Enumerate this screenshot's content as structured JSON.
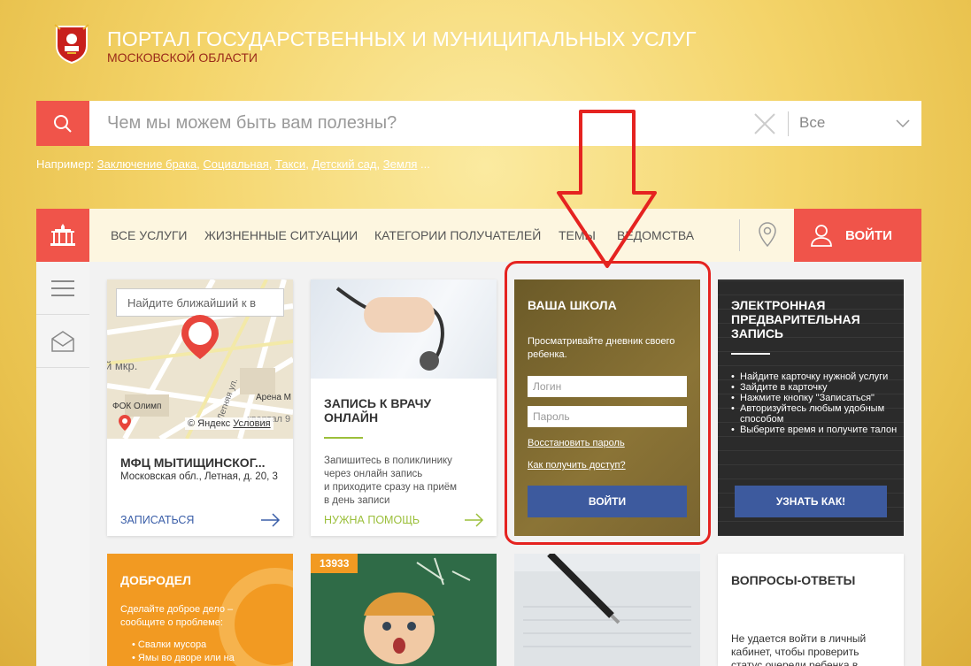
{
  "header": {
    "title": "ПОРТАЛ ГОСУДАРСТВЕННЫХ И МУНИЦИПАЛЬНЫХ УСЛУГ",
    "subtitle": "МОСКОВСКОЙ ОБЛАСТИ"
  },
  "search": {
    "placeholder": "Чем мы можем быть вам полезны?",
    "scope": "Все",
    "examples_label": "Например:",
    "examples": [
      "Заключение брака",
      "Социальная",
      "Такси",
      "Детский сад",
      "Земля"
    ],
    "ellipsis": " ..."
  },
  "nav": {
    "items": [
      "ВСЕ УСЛУГИ",
      "ЖИЗНЕННЫЕ СИТУАЦИИ",
      "КАТЕГОРИИ ПОЛУЧАТЕЛЕЙ",
      "ТЕМЫ",
      "ВЕДОМСТВА"
    ],
    "login": "ВОЙТИ"
  },
  "mfc": {
    "map_placeholder": "Найдите ближайший к в",
    "map_labels": [
      "й мкр.",
      "ФОК Олимп",
      "Арена М",
      "Летняя ул.",
      "квартал 9"
    ],
    "yandex": "© Яндекс",
    "terms": "Условия",
    "title": "МФЦ МЫТИЩИНСКОГ...",
    "address": "Московская обл., Летная, д. 20, 3",
    "link": "ЗАПИСАТЬСЯ"
  },
  "doctor": {
    "title": "ЗАПИСЬ К ВРАЧУ ОНЛАЙН",
    "text": [
      "Запишитесь в поликлинику",
      "через онлайн запись",
      "и приходите сразу на приём",
      "в день записи"
    ],
    "link": "НУЖНА ПОМОЩЬ"
  },
  "school": {
    "title": "ВАША ШКОЛА",
    "text": "Просматривайте дневник своего ребенка.",
    "login_placeholder": "Логин",
    "password_placeholder": "Пароль",
    "restore": "Восстановить пароль",
    "access": "Как получить доступ?",
    "button": "ВОЙТИ"
  },
  "queue": {
    "title": "ЭЛЕКТРОННАЯ ПРЕДВАРИТЕЛЬНАЯ ЗАПИСЬ",
    "items": [
      "Найдите карточку нужной услуги",
      "Зайдите в карточку",
      "Нажмите кнопку \"Записаться\"",
      "Авторизуйтесь любым удобным способом",
      "Выберите время и получите талон"
    ],
    "button": "УЗНАТЬ КАК!"
  },
  "dobrodel": {
    "title": "ДОБРОДЕЛ",
    "text": "Сделайте доброе дело – сообщите о проблеме:",
    "items": [
      "Свалки мусора",
      "Ямы во дворе или на"
    ]
  },
  "kids": {
    "badge": "13933"
  },
  "faq": {
    "title": "ВОПРОСЫ-ОТВЕТЫ",
    "text": "Не удается войти в личный кабинет, чтобы проверить статус очереди ребенка в"
  },
  "colors": {
    "accent": "#f0544a",
    "blue": "#3d5a9e",
    "green": "#9bbf3a",
    "highlight": "#e52320"
  }
}
